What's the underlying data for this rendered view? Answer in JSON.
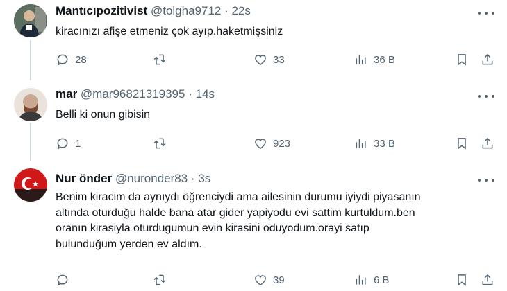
{
  "tweets": [
    {
      "name": "Mantıcıpozitivist",
      "handle": "@tolgha9712",
      "separator": "·",
      "time": "22s",
      "text": "kiracınızı afişe etmeniz çok ayıp.haketmişsiniz",
      "replies": "28",
      "retweets": "",
      "likes": "33",
      "views": "36 B"
    },
    {
      "name": "mar",
      "handle": "@mar96821319395",
      "separator": "·",
      "time": "14s",
      "text": "Belli ki onun gibisin",
      "replies": "1",
      "retweets": "",
      "likes": "923",
      "views": "33 B"
    },
    {
      "name": "Nur önder",
      "handle": "@nuronder83",
      "separator": "·",
      "time": "3s",
      "text_lines": [
        "Benim kiracim da aynıydı öğrenciydi ama ailesinin durumu iyiydi  piyasanın",
        "altında oturduğu halde bana atar gider yapiyodu evi sattim kurtuldum.ben",
        "oranın kirasiyla oturdugumun evin kirasini oduyodum.orayi satıp",
        "bulunduğum yerden ev aldım."
      ],
      "replies": "",
      "retweets": "",
      "likes": "39",
      "views": "6 B"
    }
  ],
  "icons": {
    "reply": "reply-icon",
    "retweet": "retweet-icon",
    "like": "heart-icon",
    "views": "views-icon",
    "bookmark": "bookmark-icon",
    "share": "share-icon",
    "more": "more-icon"
  },
  "colors": {
    "text": "#0f1419",
    "secondary": "#536471",
    "thread_line": "#cfd9de"
  }
}
